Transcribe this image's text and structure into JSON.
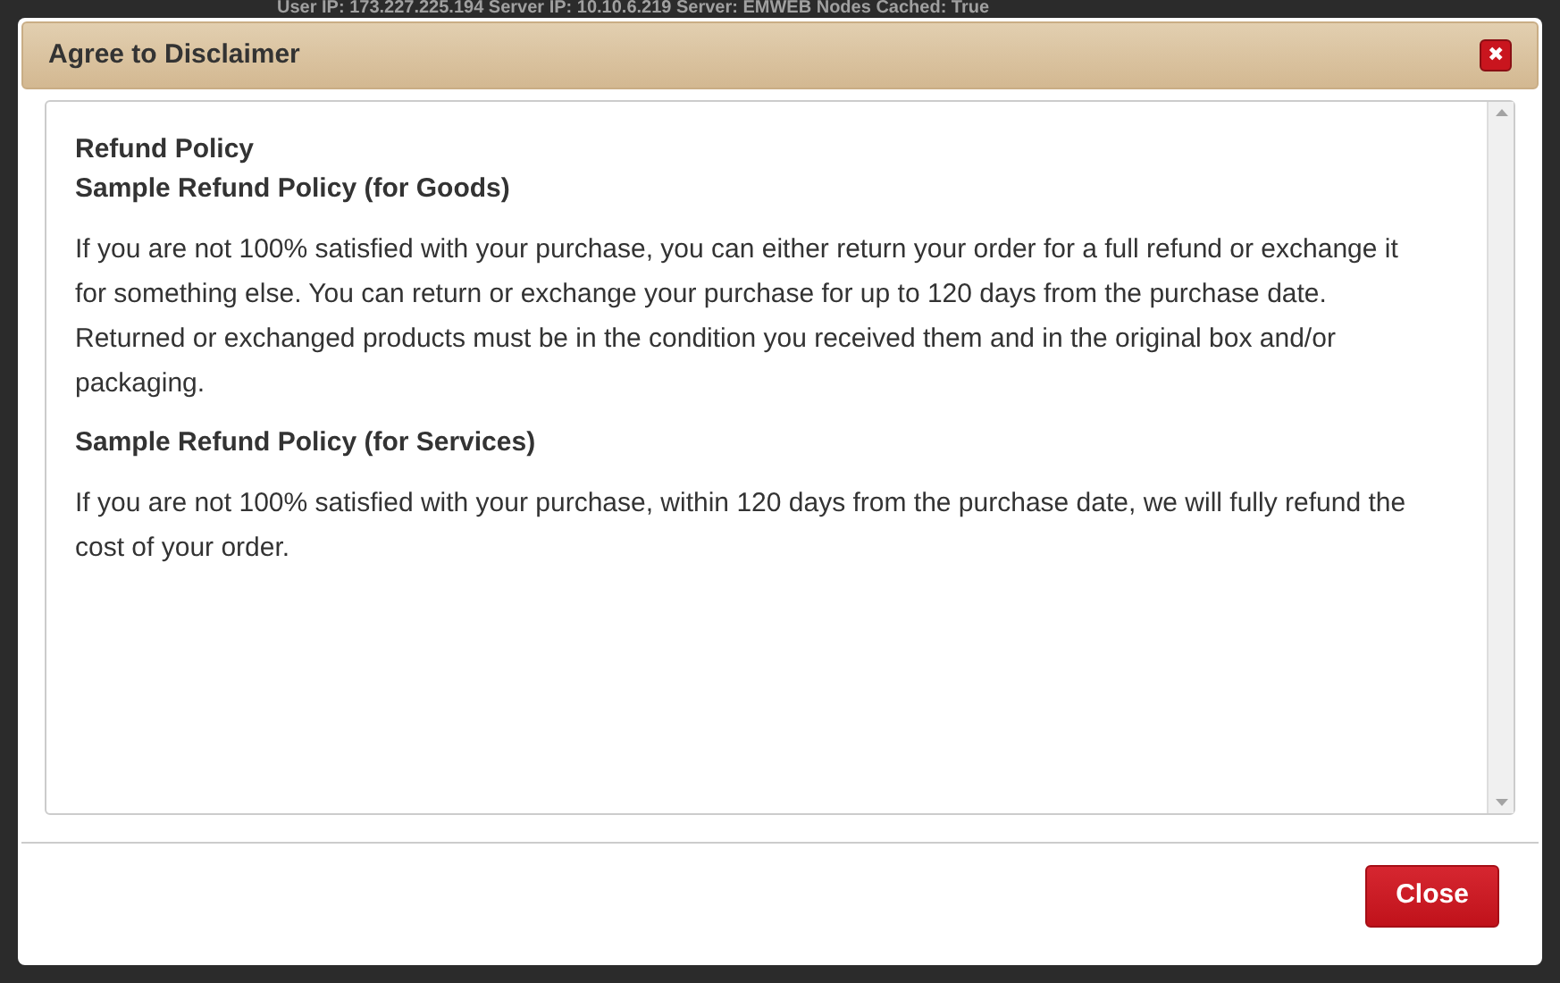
{
  "background": {
    "status_line": "User IP: 173.227.225.194 Server IP: 10.10.6.219 Server: EMWEB Nodes Cached: True"
  },
  "dialog": {
    "title": "Agree to Disclaimer",
    "close_icon": "✖",
    "content": [
      {
        "kind": "heading",
        "text": "Refund Policy"
      },
      {
        "kind": "subheading",
        "text": "Sample Refund Policy (for Goods)"
      },
      {
        "kind": "paragraph",
        "text": "If you are not 100% satisfied with your purchase, you can either return your order for a full refund or exchange it for something else. You can return or exchange your purchase for up to 120 days from the purchase date. Returned or exchanged products must be in the condition you received them and in the original box and/or packaging."
      },
      {
        "kind": "subheading",
        "text": "Sample Refund Policy (for Services)"
      },
      {
        "kind": "paragraph",
        "text": "If you are not 100% satisfied with your purchase, within 120 days from the purchase date, we will fully refund the cost of your order."
      }
    ],
    "buttons": [
      "Close"
    ]
  }
}
